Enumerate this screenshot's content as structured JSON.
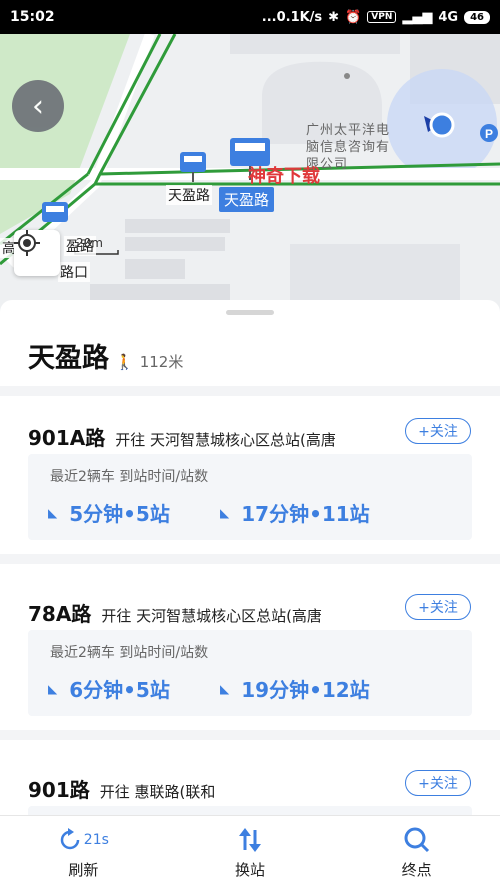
{
  "status_bar": {
    "time": "15:02",
    "network_speed": "...0.1K/s",
    "vpn": "VPN",
    "signal": "4G",
    "battery": "46"
  },
  "map": {
    "poi_label": "广州太平洋电脑信息咨询有限公司",
    "road_labels": [
      "天盈路",
      "高",
      "盈路",
      "路口"
    ],
    "selected_stop": "天盈路",
    "scale": "20m",
    "watermark": "神奇下载",
    "icons": [
      "back-icon",
      "locate-icon",
      "bus-stop-icon",
      "user-location-icon",
      "parking-icon"
    ]
  },
  "sheet": {
    "stop_name": "天盈路",
    "walk_distance": "112米"
  },
  "routes": [
    {
      "number": "901A路",
      "direction": "开往 天河智慧城核心区总站(高唐",
      "follow": "+关注",
      "caption": "最近2辆车 到站时间/站数",
      "etas": [
        "5分钟•5站",
        "17分钟•11站"
      ]
    },
    {
      "number": "78A路",
      "direction": "开往 天河智慧城核心区总站(高唐",
      "follow": "+关注",
      "caption": "最近2辆车 到站时间/站数",
      "etas": [
        "6分钟•5站",
        "19分钟•12站"
      ]
    },
    {
      "number": "901路",
      "direction": "开往 惠联路(联和",
      "follow": "+关注"
    }
  ],
  "bottom_bar": {
    "refresh_label": "刷新",
    "refresh_countdown": "21s",
    "switch_label": "换站",
    "terminal_label": "终点"
  },
  "colors": {
    "accent": "#3d7fe0",
    "route_line": "#2f9b3a"
  }
}
